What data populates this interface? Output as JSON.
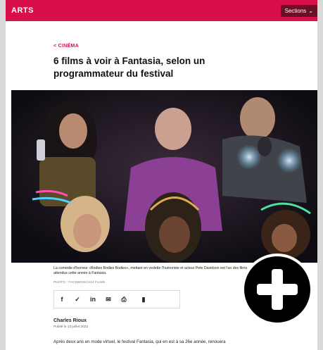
{
  "header": {
    "section": "ARTS",
    "sections_label": "Sections",
    "sections_icon": "chevron-down-icon",
    "accent_color": "#d90f4a"
  },
  "article": {
    "category": "< CINÉMA",
    "title": "6 films à voir à Fantasia, selon un programmateur du festival",
    "image_caption": "La comédie d'horreur «Bodies Bodies Bodies», mettant en vedette l'humoriste et acteur Pete Davidson est l'un des films attendus cette année à Fantasia.",
    "image_credit": "PHOTO : FACEBOOK/A24 FILMS",
    "author": "Charles Rioux",
    "published": "Publié le 13 juillet 2022",
    "lead": "Après deux ans en mode virtuel, le festival Fantasia, qui en est à sa 26e année, renouera"
  },
  "share": {
    "icons": [
      "facebook-icon",
      "twitter-icon",
      "linkedin-icon",
      "email-icon",
      "print-icon",
      "comments-icon"
    ],
    "glyphs": [
      "f",
      "🐦",
      "in",
      "✉",
      "🖶",
      "💬"
    ]
  },
  "overlay": {
    "icon": "plus-icon"
  }
}
